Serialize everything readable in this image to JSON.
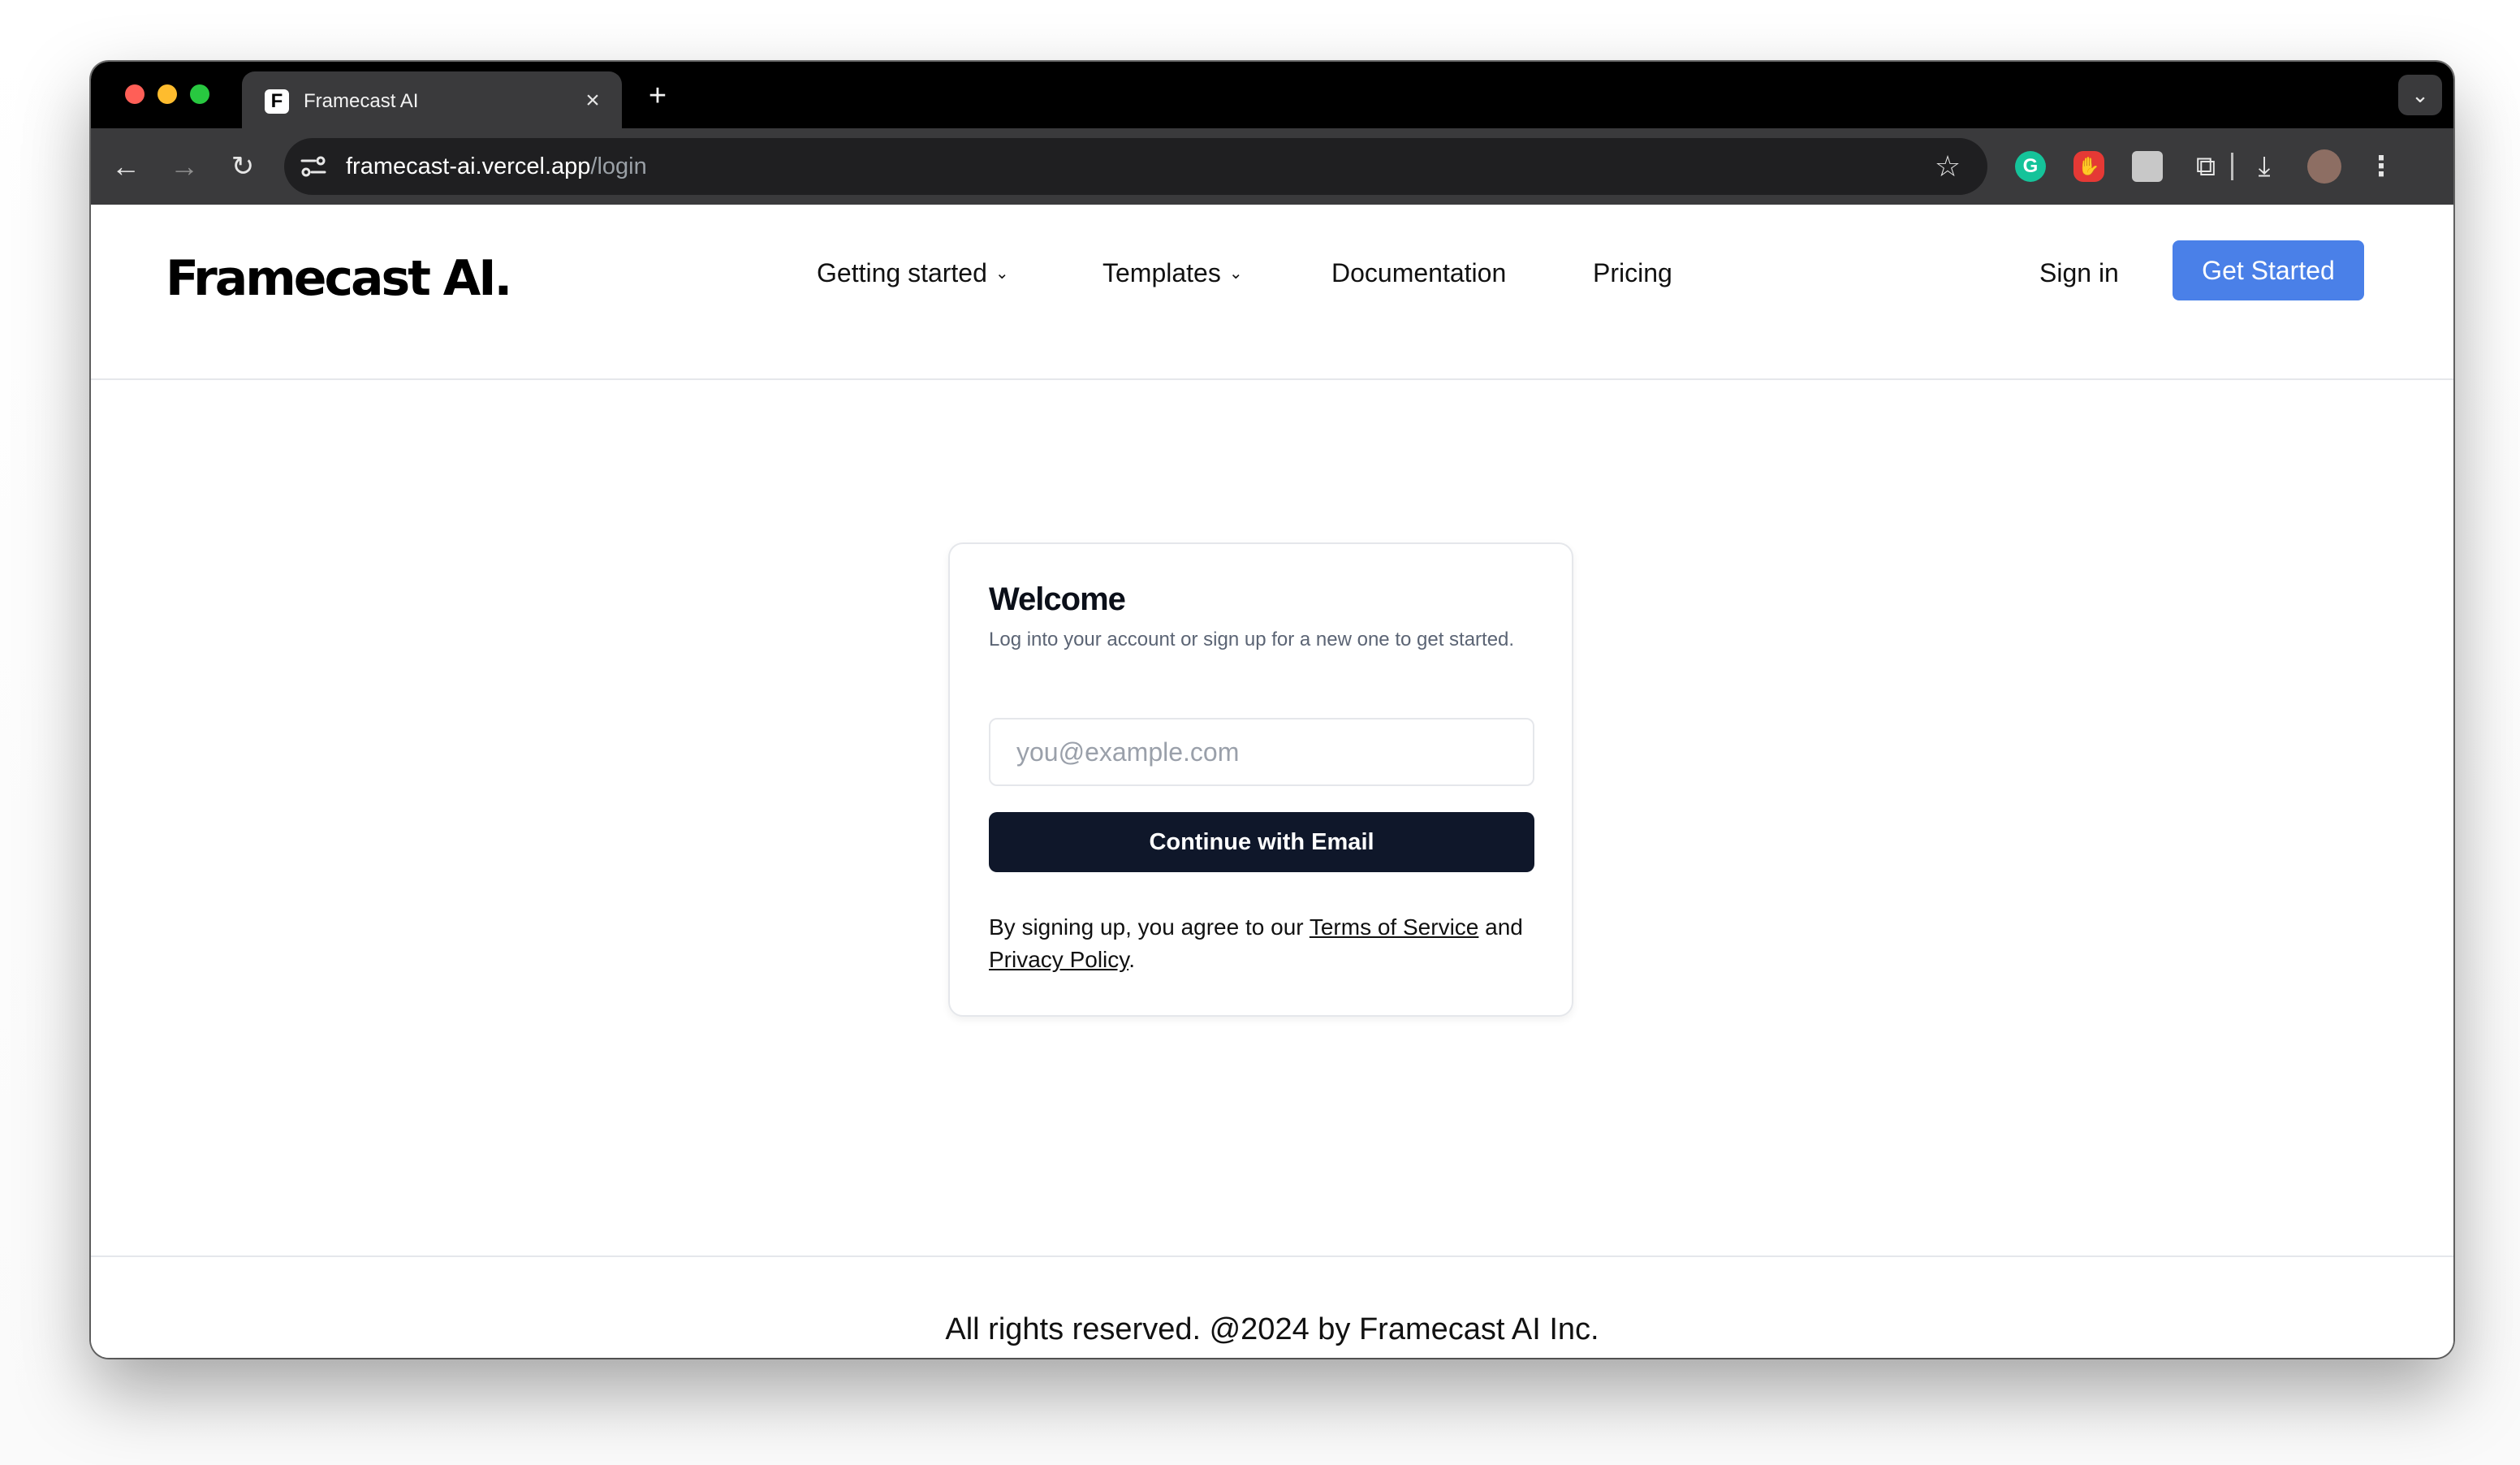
{
  "browser": {
    "tab_title": "Framecast AI",
    "tab_favicon_letter": "F",
    "new_tab_glyph": "+",
    "url_host": "framecast-ai.vercel.app",
    "url_path": "/login",
    "icons": [
      "back-arrow-icon",
      "forward-arrow-icon",
      "reload-icon",
      "site-info-icon",
      "star-icon",
      "grammarly-icon",
      "adblock-icon",
      "extension-icon",
      "puzzle-icon",
      "download-icon",
      "profile-avatar",
      "kebab-menu-icon"
    ]
  },
  "header": {
    "logo": "Framecast AI.",
    "nav": [
      {
        "label": "Getting started",
        "has_dropdown": true
      },
      {
        "label": "Templates",
        "has_dropdown": true
      },
      {
        "label": "Documentation",
        "has_dropdown": false
      },
      {
        "label": "Pricing",
        "has_dropdown": false
      }
    ],
    "sign_in": "Sign in",
    "get_started": "Get Started"
  },
  "login": {
    "title": "Welcome",
    "subtitle": "Log into your account or sign up for a new one to get started.",
    "email_placeholder": "you@example.com",
    "email_value": "",
    "continue_label": "Continue with Email",
    "legal_prefix": "By signing up, you agree to our ",
    "terms_label": "Terms of Service",
    "legal_mid": " and ",
    "privacy_label": "Privacy Policy",
    "legal_suffix": "."
  },
  "footer": {
    "text": "All rights reserved. @2024 by Framecast AI Inc."
  },
  "colors": {
    "accent": "#4a80e8",
    "primary_button": "#0f172a",
    "border": "#e5e7eb",
    "muted_text": "#5b6474"
  }
}
